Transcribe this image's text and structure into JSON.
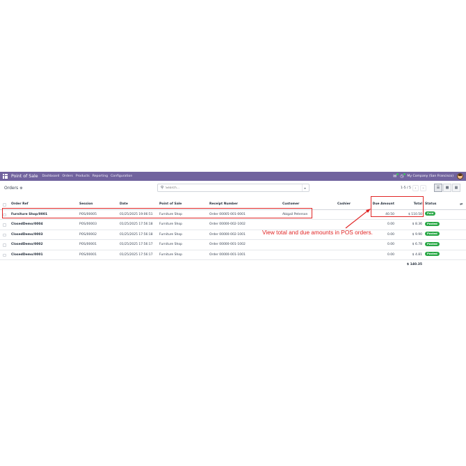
{
  "navbar": {
    "app_name": "Point of Sale",
    "menu": [
      "Dashboard",
      "Orders",
      "Products",
      "Reporting",
      "Configuration"
    ],
    "company": "My Company (San Francisco)"
  },
  "control": {
    "breadcrumb": "Orders",
    "search_placeholder": "Search...",
    "pager": "1-5 / 5"
  },
  "table": {
    "columns": {
      "ref": "Order Ref",
      "session": "Session",
      "date": "Date",
      "pos": "Point of Sale",
      "receipt": "Receipt Number",
      "customer": "Customer",
      "cashier": "Cashier",
      "due": "Due Amount",
      "total": "Total",
      "status": "Status"
    },
    "rows": [
      {
        "ref": "Furniture Shop/0001",
        "session": "POS/00005",
        "date": "01/25/2025 19:06:51",
        "pos": "Furniture Shop",
        "receipt": "Order 00005-001-0001",
        "customer": "Abigail Peterson",
        "cashier": "",
        "due": "40.50",
        "total": "$ 110.50",
        "status": "Paid"
      },
      {
        "ref": "ClosedDemo/0004",
        "session": "POS/00003",
        "date": "01/25/2025 17:56:18",
        "pos": "Furniture Shop",
        "receipt": "Order 00000-002-1002",
        "customer": "",
        "cashier": "",
        "due": "0.00",
        "total": "$ 8.36",
        "status": "Posted"
      },
      {
        "ref": "ClosedDemo/0003",
        "session": "POS/00002",
        "date": "01/25/2025 17:56:18",
        "pos": "Furniture Shop",
        "receipt": "Order 00000-002-1001",
        "customer": "",
        "cashier": "",
        "due": "0.00",
        "total": "$ 9.90",
        "status": "Posted"
      },
      {
        "ref": "ClosedDemo/0002",
        "session": "POS/00001",
        "date": "01/25/2025 17:56:17",
        "pos": "Furniture Shop",
        "receipt": "Order 00000-001-1002",
        "customer": "",
        "cashier": "",
        "due": "0.00",
        "total": "$ 6.78",
        "status": "Posted"
      },
      {
        "ref": "ClosedDemo/0001",
        "session": "POS/00001",
        "date": "01/25/2025 17:56:17",
        "pos": "Furniture Shop",
        "receipt": "Order 00000-001-1001",
        "customer": "",
        "cashier": "",
        "due": "0.00",
        "total": "$ 4.81",
        "status": "Posted"
      }
    ],
    "footer_total": "$ 140.35"
  },
  "annotation": {
    "text": "View total and due amounts in POS orders.",
    "color": "#e02424"
  },
  "colors": {
    "navbar": "#71639e",
    "badge": "#28a745"
  },
  "icons": {
    "apps": "apps-grid-icon",
    "chat": "chat-icon",
    "activity": "activity-icon",
    "settings": "gear-icon",
    "search": "search-icon",
    "list_view": "list-view-icon",
    "kanban_view": "kanban-view-icon",
    "grid_view": "grid-view-icon"
  }
}
